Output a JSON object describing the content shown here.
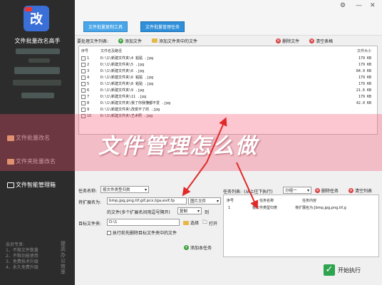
{
  "app": {
    "title": "文件批量改名高手",
    "logo_char": "改"
  },
  "window_controls": {
    "settings": "⚙",
    "minimize": "—",
    "close": "✕"
  },
  "sidebar": {
    "nav": [
      {
        "label": "文件批量改名"
      },
      {
        "label": "文件夹批量改名"
      },
      {
        "label": "文件智能管理箱"
      }
    ],
    "member_lines": [
      "会员专享:",
      "1、不限文件数量",
      "2、不限功能使用",
      "3、免费技术升级",
      "4、永久免费升级"
    ],
    "upgrade": "提高办公效率"
  },
  "toolbar": {
    "tab1": "文件批量复制工具",
    "tab2": "文件批量管理任务"
  },
  "file_list": {
    "label": "要处理文件列表:",
    "add_file": "添加文件",
    "add_folder": "添加文件夹中的文件",
    "delete_file": "删除文件",
    "clear_table": "清空表格",
    "headers": {
      "no": "序号",
      "path": "文件名及路径",
      "size": "文件大小"
    },
    "rows": [
      {
        "no": "1",
        "path": "D:\\1\\新建文件夹\\4 粘贴 .jpg",
        "size": "179 KB"
      },
      {
        "no": "2",
        "path": "D:\\1\\新建文件夹\\5 .jpg",
        "size": "179 KB"
      },
      {
        "no": "3",
        "path": "D:\\1\\新建文件夹\\6 .jpg",
        "size": "84.9 KB"
      },
      {
        "no": "4",
        "path": "D:\\1\\新建文件夹\\6 粘贴 .jpg",
        "size": "179 KB"
      },
      {
        "no": "5",
        "path": "D:\\1\\新建文件夹\\8 粘贴 .jpg",
        "size": "179 KB"
      },
      {
        "no": "6",
        "path": "D:\\1\\新建文件夹\\9 .jpg",
        "size": "21.6 KB"
      },
      {
        "no": "7",
        "path": "D:\\1\\新建文件夹\\11 .jpg",
        "size": "179 KB"
      },
      {
        "no": "8",
        "path": "D:\\1\\新建文件夹\\我了你我懂都不爱 .jpg",
        "size": "42.0 KB"
      },
      {
        "no": "9",
        "path": "D:\\1\\新建文件夹\\改变不了的 .jpg",
        "size": ""
      },
      {
        "no": "10",
        "path": "D:\\1\\新建文件夹\\艺术照 .jpg",
        "size": ""
      }
    ]
  },
  "banner": {
    "text": "文件管理怎么做"
  },
  "task_config": {
    "task_name_label": "任务名称:",
    "task_name_value": "按文件类型归类",
    "ext_label": "将扩展名为:",
    "ext_value": "bmp,jpg,png,tif,gif,pcx,tga,exif,fp",
    "category_value": "图片文件",
    "files_label": "的文件(多个扩展名间用逗号隔开)",
    "op_value": "复制",
    "to_label": "到",
    "target_label": "目标文件夹:",
    "target_value": "D:\\1",
    "choose": "选择",
    "open": "打开",
    "clear_first": "执行前先删除目标文件夹中的文件",
    "add_task": "添加本任务"
  },
  "task_list": {
    "label": "任务列表:",
    "order_label": "(从上往下执行)",
    "group_value": "分组一",
    "delete_task": "删除任务",
    "clear_list": "清空列表",
    "headers": {
      "no": "序号",
      "name": "任务名称",
      "content": "任务内容"
    },
    "rows": [
      {
        "no": "1",
        "name": "按文件类型归类",
        "content": "将扩展名为:[bmp,jpg,png,tif,g"
      }
    ]
  },
  "run": {
    "label": "开始执行"
  }
}
